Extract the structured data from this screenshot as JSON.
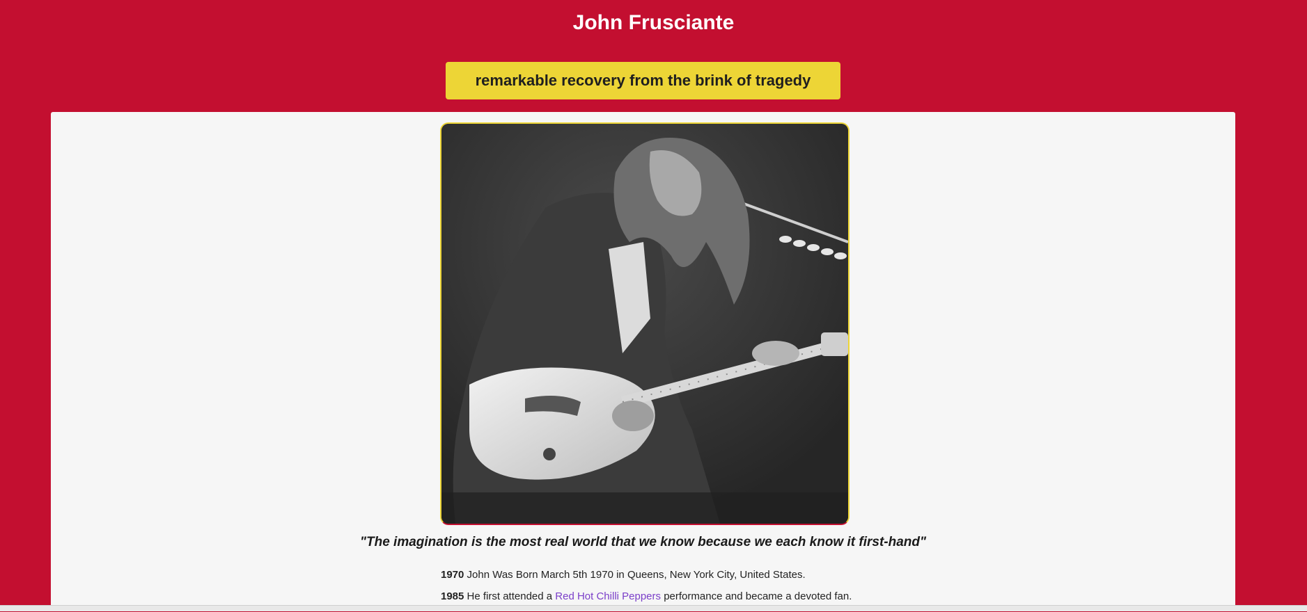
{
  "header": {
    "title": "John Frusciante",
    "subtitle": "remarkable recovery from the brink of tragedy"
  },
  "main": {
    "photo": {
      "subject": "black-and-white photo of guitarist playing a Stratocaster at a microphone"
    },
    "quote": "\"The imagination is the most real world that we know because we each know it first-hand\"",
    "timeline": [
      {
        "year": "1970",
        "text": " John Was Born March 5th 1970 in Queens, New York City, United States."
      },
      {
        "year": "1985",
        "before": " He first attended a ",
        "link": "Red Hot Chilli Peppers",
        "after": " performance and became a devoted fan."
      }
    ]
  },
  "colors": {
    "background": "#c30f30",
    "banner": "#edd536",
    "card": "#f6f6f6",
    "link": "#7b3fc9"
  }
}
